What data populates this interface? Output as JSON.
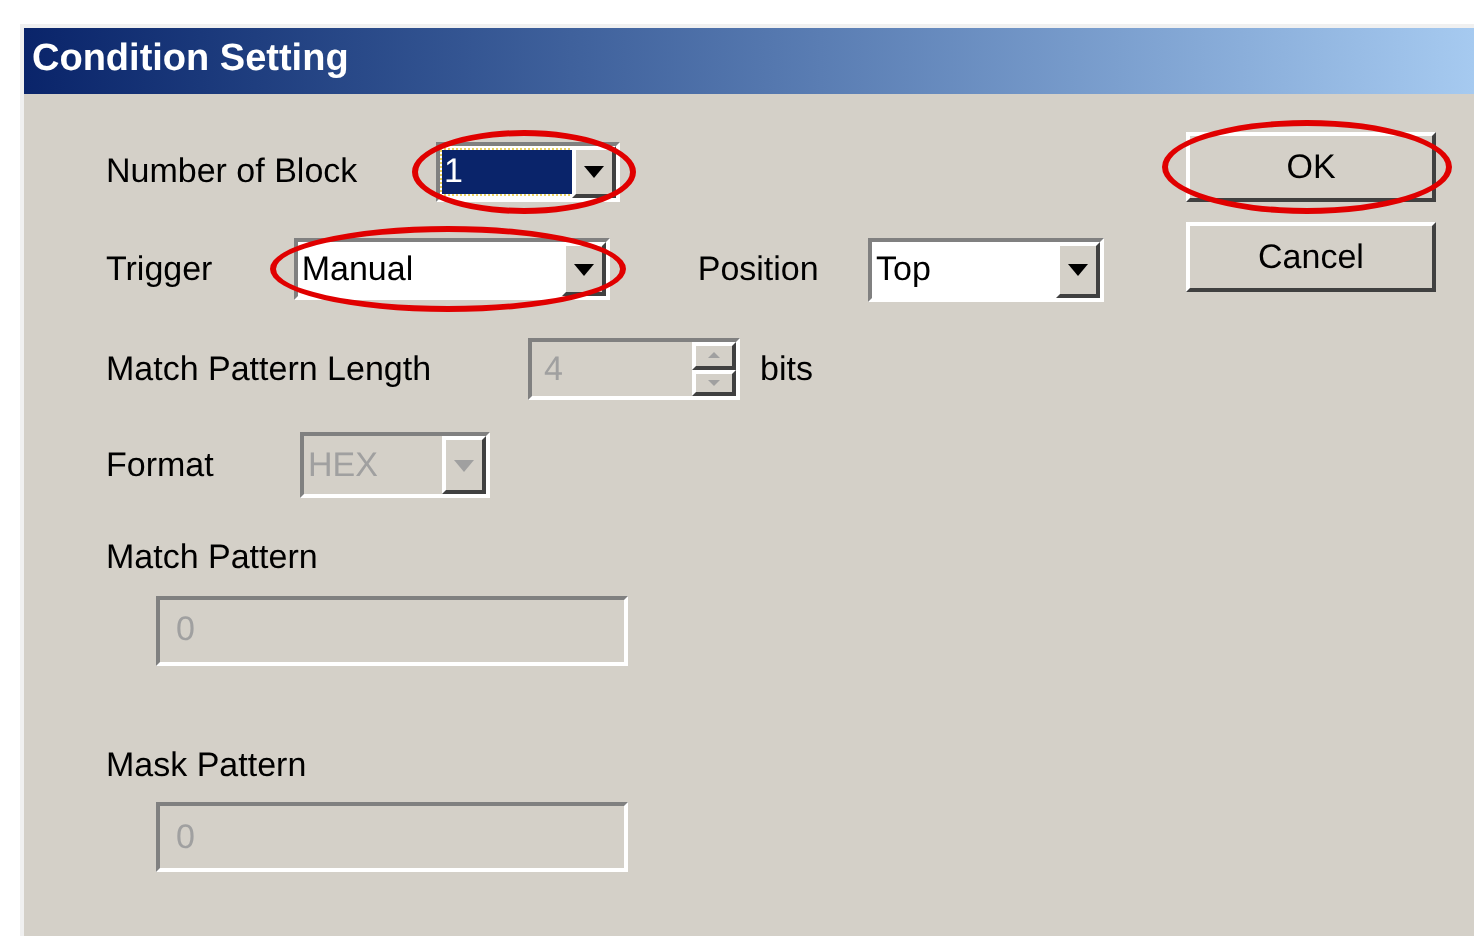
{
  "window": {
    "title": "Condition Setting"
  },
  "number_of_block": {
    "label": "Number of Block",
    "value": "1",
    "focused": true,
    "highlighted": true
  },
  "trigger": {
    "label": "Trigger",
    "value": "Manual",
    "highlighted": true
  },
  "position": {
    "label": "Position",
    "value": "Top"
  },
  "match_pattern_length": {
    "label": "Match Pattern Length",
    "value": "4",
    "unit": "bits",
    "disabled": true
  },
  "format": {
    "label": "Format",
    "value": "HEX",
    "disabled": true
  },
  "match_pattern": {
    "label": "Match Pattern",
    "value": "0",
    "disabled": true
  },
  "mask_pattern": {
    "label": "Mask Pattern",
    "value": "0",
    "disabled": true
  },
  "buttons": [
    {
      "label": "OK",
      "highlighted": true
    },
    {
      "label": "Cancel",
      "highlighted": false
    }
  ]
}
